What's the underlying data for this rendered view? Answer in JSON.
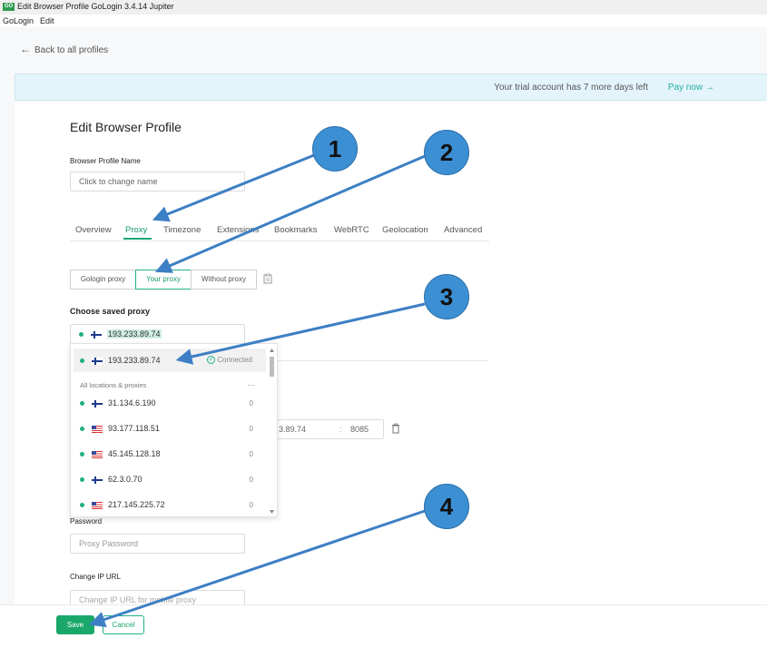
{
  "window": {
    "title": "Edit Browser Profile GoLogin 3.4.14 Jupiter",
    "app_icon": "GO"
  },
  "menu": [
    "GoLogin",
    "Edit"
  ],
  "nav": {
    "back": "Back to all profiles"
  },
  "banner": {
    "message": "Your trial account has 7 more days left",
    "pay": "Pay now"
  },
  "form": {
    "heading": "Edit Browser Profile",
    "name_label": "Browser Profile Name",
    "name_placeholder": "Click to change name",
    "tabs": [
      "Overview",
      "Proxy",
      "Timezone",
      "Extensions",
      "Bookmarks",
      "WebRTC",
      "Geolocation",
      "Advanced"
    ],
    "active_tab": "Proxy",
    "proxy_modes": [
      "Gologin proxy",
      "Your proxy",
      "Without proxy"
    ],
    "active_mode": "Your proxy",
    "saved_proxy_label": "Choose saved proxy",
    "selected_proxy": "193.233.89.74",
    "host_value": "3.89.74",
    "port_value": "8085",
    "password_label": "Password",
    "password_placeholder": "Proxy Password",
    "change_ip_label": "Change IP URL",
    "change_ip_placeholder": "Change IP URL for mobile proxy"
  },
  "dropdown": {
    "current": {
      "ip": "193.233.89.74",
      "flag": "fi",
      "status": "Connected"
    },
    "section_label": "All locations & proxies",
    "more": "…",
    "items": [
      {
        "ip": "31.134.6.190",
        "flag": "fi",
        "count": "0"
      },
      {
        "ip": "93.177.118.51",
        "flag": "us",
        "count": "0"
      },
      {
        "ip": "45.145.128.18",
        "flag": "us",
        "count": "0"
      },
      {
        "ip": "62.3.0.70",
        "flag": "fi",
        "count": "0"
      },
      {
        "ip": "217.145.225.72",
        "flag": "us",
        "count": "0"
      }
    ]
  },
  "markers": [
    "1",
    "2",
    "3",
    "4"
  ],
  "buttons": {
    "save": "Save",
    "cancel": "Cancel"
  },
  "colors": {
    "accent": "#1aa76a",
    "marker": "#3c8fd3",
    "banner": "#e3f4fa"
  }
}
